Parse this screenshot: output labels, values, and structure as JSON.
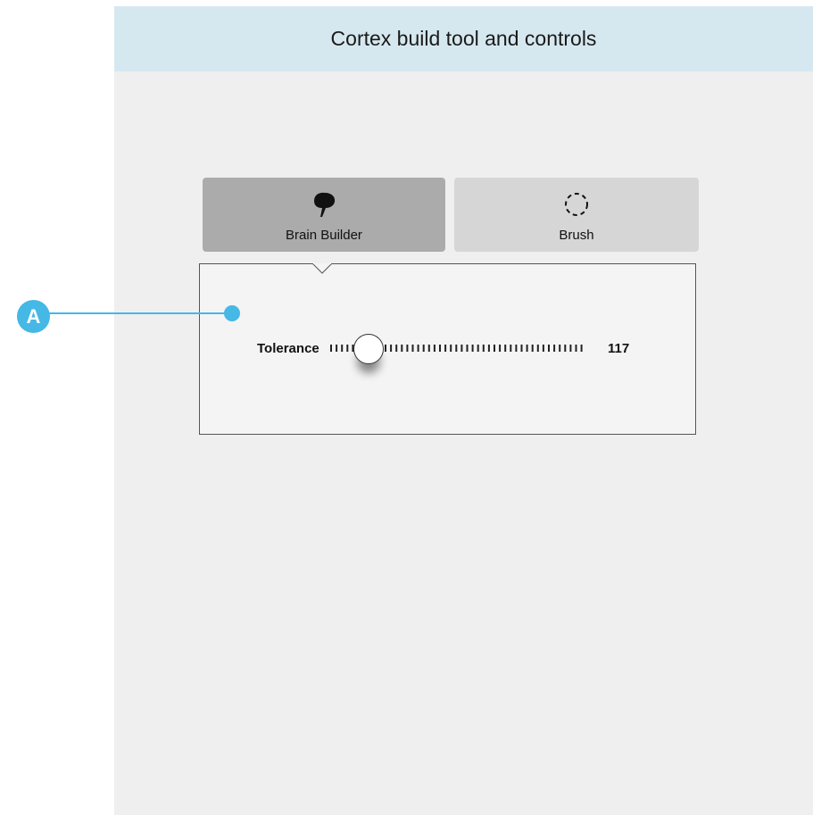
{
  "header": {
    "title": "Cortex build tool and controls"
  },
  "tabs": [
    {
      "label": "Brain Builder",
      "icon": "brain-icon",
      "selected": true
    },
    {
      "label": "Brush",
      "icon": "dashed-circle-icon",
      "selected": false
    }
  ],
  "tolerance": {
    "label": "Tolerance",
    "value": "117",
    "level": 0.15
  },
  "annotation": {
    "label": "A"
  },
  "colors": {
    "header_bg": "#d6e8ef",
    "selected_tab": "#ababab",
    "unselected_tab": "#d6d6d6",
    "annotation": "#45b8e6"
  }
}
